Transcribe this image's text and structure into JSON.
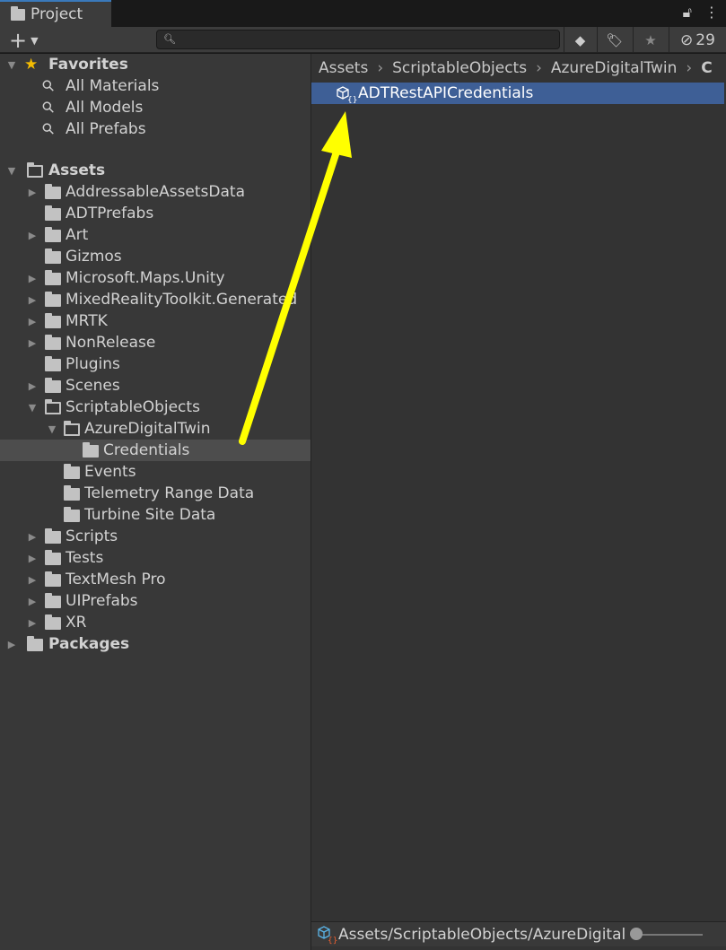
{
  "tab": {
    "title": "Project",
    "lock_icon": "lock-icon",
    "menu_icon": "kebab-menu-icon"
  },
  "toolbar": {
    "create_label": "+",
    "search_placeholder": "",
    "hidden_count": "29"
  },
  "tree": {
    "favorites": {
      "label": "Favorites",
      "items": [
        "All Materials",
        "All Models",
        "All Prefabs"
      ]
    },
    "assets_label": "Assets",
    "items": [
      {
        "label": "AddressableAssetsData",
        "level": 1,
        "arrow": "right"
      },
      {
        "label": "ADTPrefabs",
        "level": 1,
        "arrow": ""
      },
      {
        "label": "Art",
        "level": 1,
        "arrow": "right"
      },
      {
        "label": "Gizmos",
        "level": 1,
        "arrow": ""
      },
      {
        "label": "Microsoft.Maps.Unity",
        "level": 1,
        "arrow": "right"
      },
      {
        "label": "MixedRealityToolkit.Generated",
        "level": 1,
        "arrow": "right"
      },
      {
        "label": "MRTK",
        "level": 1,
        "arrow": "right"
      },
      {
        "label": "NonRelease",
        "level": 1,
        "arrow": "right"
      },
      {
        "label": "Plugins",
        "level": 1,
        "arrow": ""
      },
      {
        "label": "Scenes",
        "level": 1,
        "arrow": "right"
      },
      {
        "label": "ScriptableObjects",
        "level": 1,
        "arrow": "down",
        "open": true
      },
      {
        "label": "AzureDigitalTwin",
        "level": 2,
        "arrow": "down",
        "open": true
      },
      {
        "label": "Credentials",
        "level": 3,
        "arrow": "",
        "selected": true
      },
      {
        "label": "Events",
        "level": 2,
        "arrow": ""
      },
      {
        "label": "Telemetry Range Data",
        "level": 2,
        "arrow": ""
      },
      {
        "label": "Turbine Site Data",
        "level": 2,
        "arrow": ""
      },
      {
        "label": "Scripts",
        "level": 1,
        "arrow": "right"
      },
      {
        "label": "Tests",
        "level": 1,
        "arrow": "right"
      },
      {
        "label": "TextMesh Pro",
        "level": 1,
        "arrow": "right"
      },
      {
        "label": "UIPrefabs",
        "level": 1,
        "arrow": "right"
      },
      {
        "label": "XR",
        "level": 1,
        "arrow": "right"
      }
    ],
    "packages_label": "Packages"
  },
  "breadcrumb": [
    "Assets",
    "ScriptableObjects",
    "AzureDigitalTwin",
    "C"
  ],
  "assets_list": [
    {
      "name": "ADTRestAPICredentials",
      "icon": "scriptable-object-icon",
      "selected": true
    }
  ],
  "status_bar": {
    "path": "Assets/ScriptableObjects/AzureDigitalTwin/Credentials/ADTRestAPICredentials.asset",
    "zoom_slider": 0
  },
  "annotation": {
    "color": "#ffff00",
    "type": "arrow"
  },
  "colors": {
    "selection": "#3e5f96",
    "tab_accent": "#3a79bb",
    "favorites_star": "#f4bc02"
  }
}
